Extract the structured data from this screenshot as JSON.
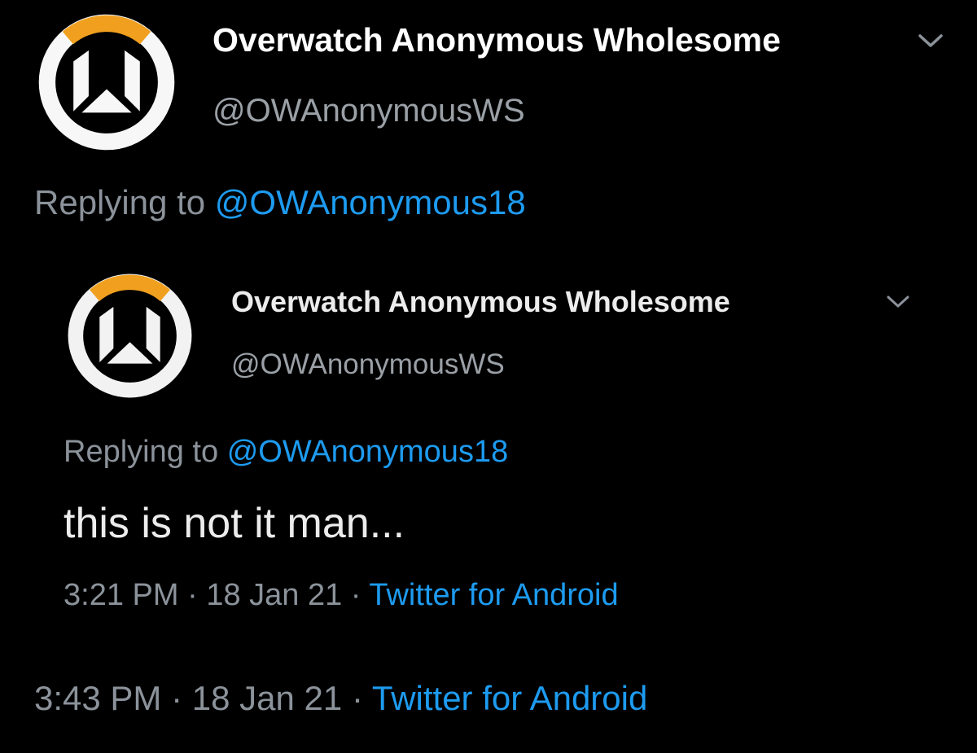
{
  "outer": {
    "author": {
      "name": "Overwatch Anonymous Wholesome",
      "handle": "@OWAnonymousWS",
      "avatar_icon": "overwatch-logo-icon"
    },
    "menu_icon": "chevron-down-icon",
    "replying_prefix": "Replying to",
    "replying_handle": "@OWAnonymous18",
    "meta": {
      "time": "3:43 PM",
      "sep1": "·",
      "date": "18 Jan 21",
      "sep2": "·",
      "source": "Twitter for Android"
    }
  },
  "quoted": {
    "author": {
      "name": "Overwatch Anonymous Wholesome",
      "handle": "@OWAnonymousWS",
      "avatar_icon": "overwatch-logo-icon"
    },
    "menu_icon": "chevron-down-icon",
    "replying_prefix": "Replying to",
    "replying_handle": "@OWAnonymous18",
    "text": "this is not it man...",
    "meta": {
      "time": "3:21 PM",
      "sep1": "·",
      "date": "18 Jan 21",
      "sep2": "·",
      "source": "Twitter for Android"
    }
  },
  "colors": {
    "background": "#000000",
    "link": "#1d9bf0",
    "muted": "#8b929a",
    "logo_orange": "#f0a01e"
  }
}
